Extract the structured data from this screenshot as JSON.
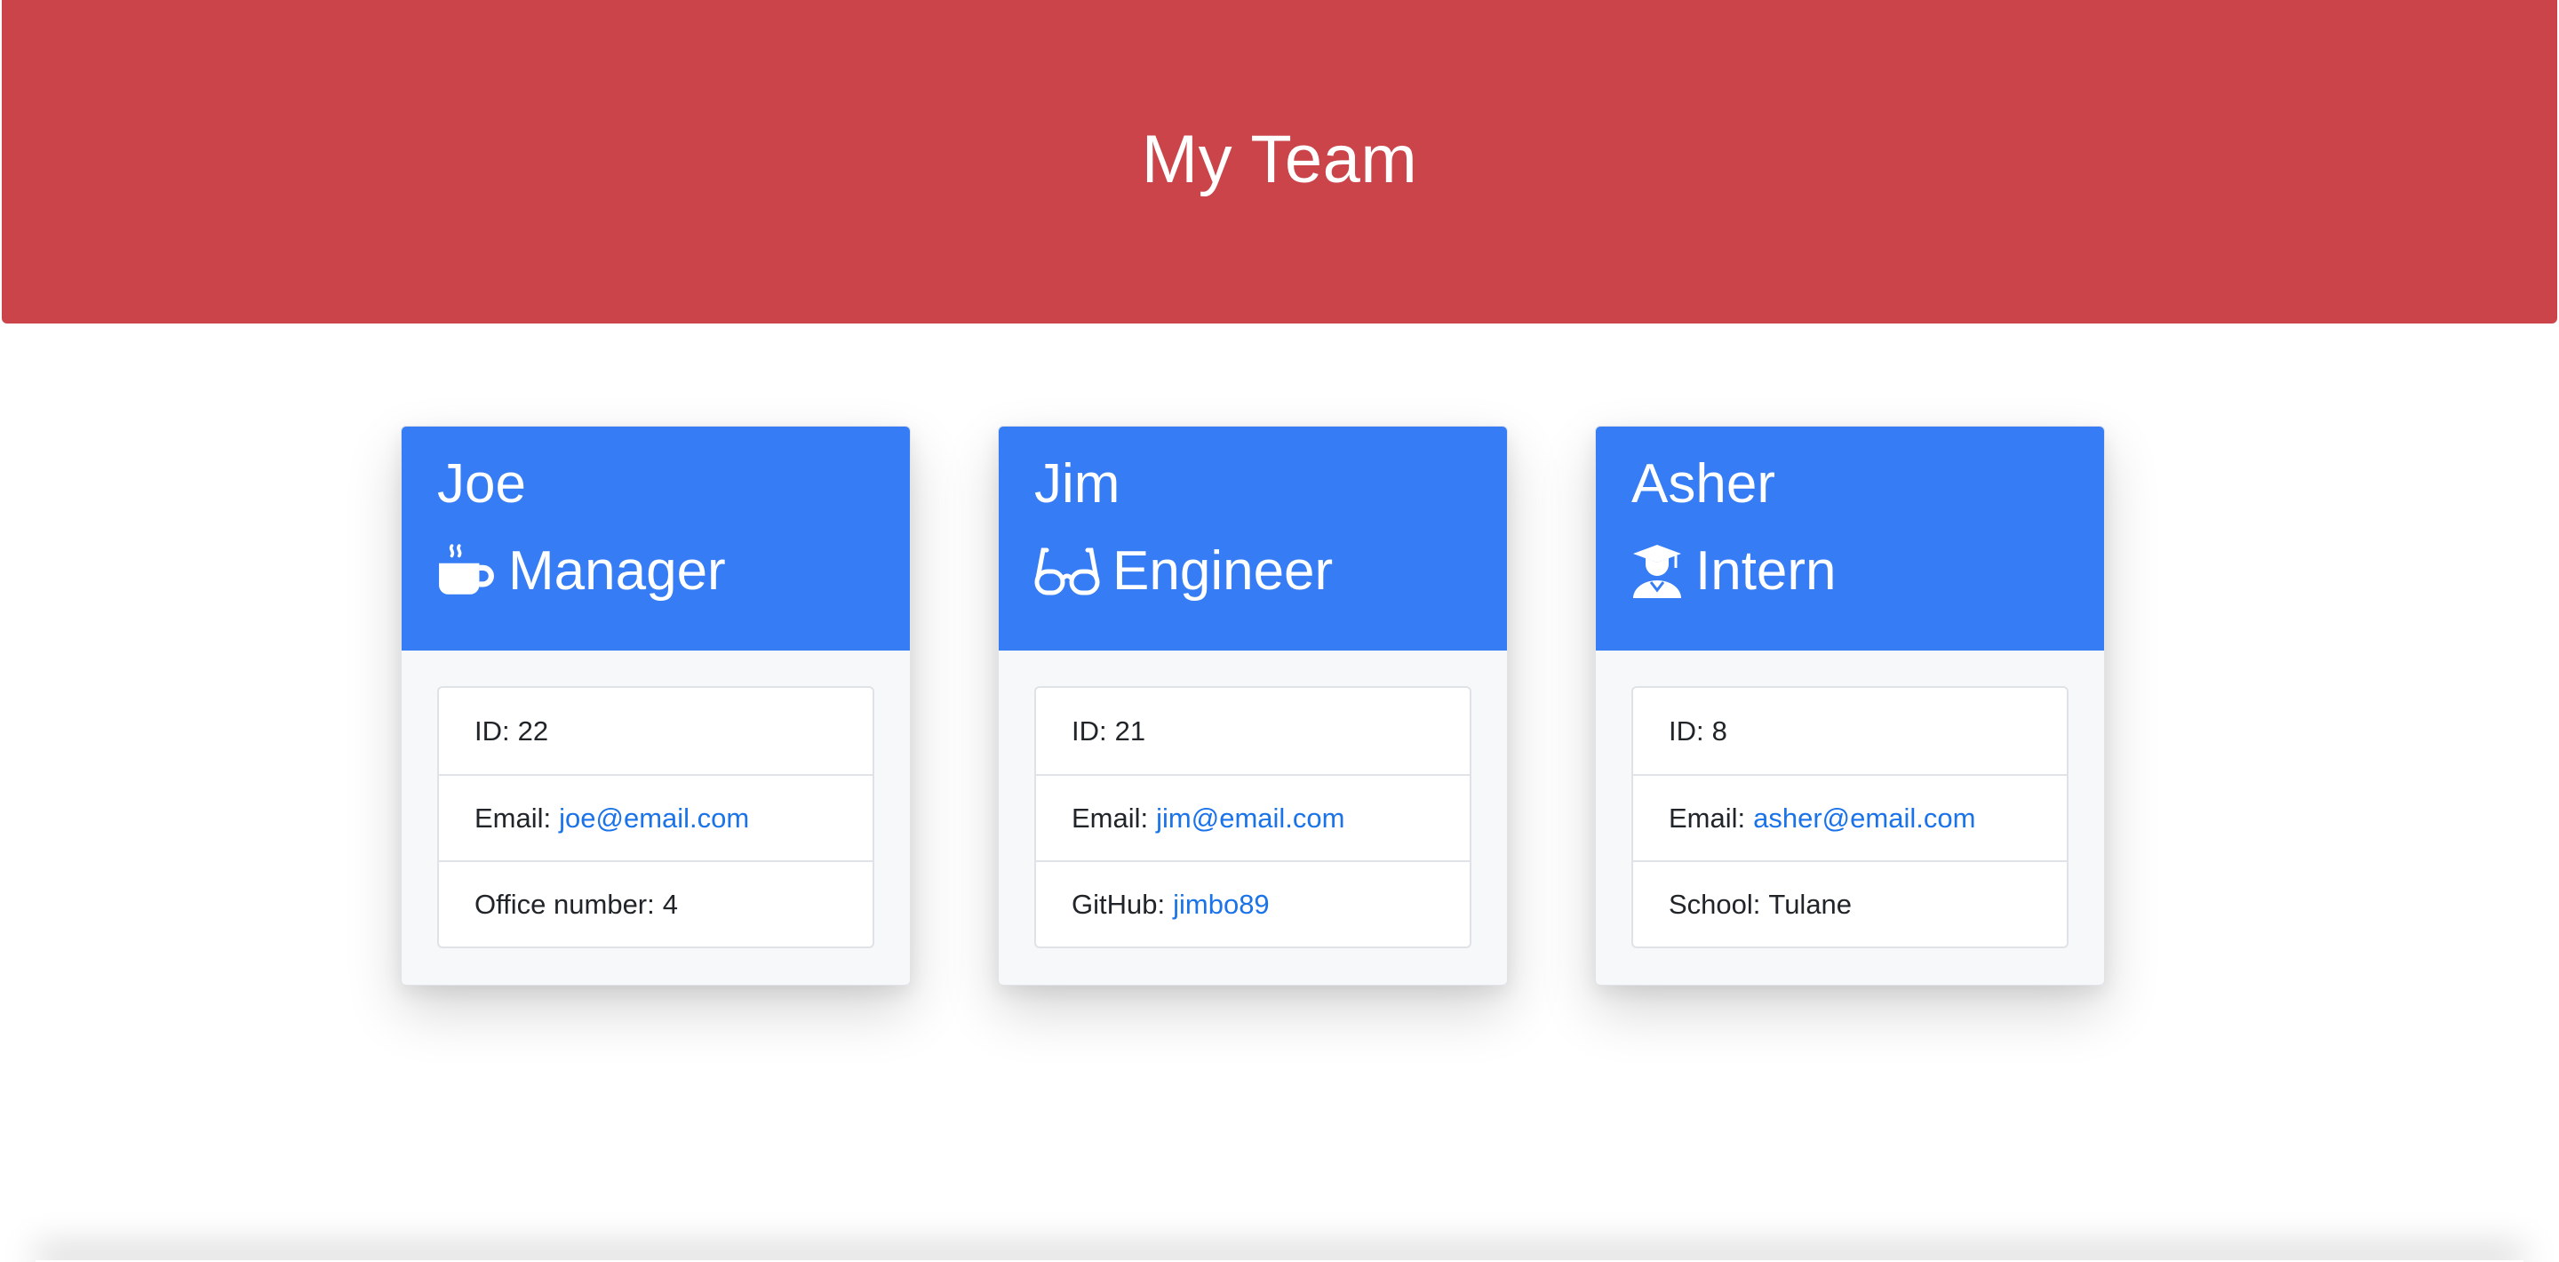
{
  "header": {
    "title": "My Team"
  },
  "colors": {
    "banner": "#ca444a",
    "card_header": "#357cf5",
    "link": "#1a73e8"
  },
  "team": [
    {
      "name": "Joe",
      "role": "Manager",
      "role_icon": "mug-hot-icon",
      "id_label": "ID:",
      "id": "22",
      "email_label": "Email:",
      "email": "joe@email.com",
      "extra_label": "Office number:",
      "extra_value": "4"
    },
    {
      "name": "Jim",
      "role": "Engineer",
      "role_icon": "glasses-icon",
      "id_label": "ID:",
      "id": "21",
      "email_label": "Email:",
      "email": "jim@email.com",
      "extra_label": "GitHub:",
      "extra_value": "jimbo89"
    },
    {
      "name": "Asher",
      "role": "Intern",
      "role_icon": "graduate-icon",
      "id_label": "ID:",
      "id": "8",
      "email_label": "Email:",
      "email": "asher@email.com",
      "extra_label": "School:",
      "extra_value": "Tulane"
    }
  ]
}
